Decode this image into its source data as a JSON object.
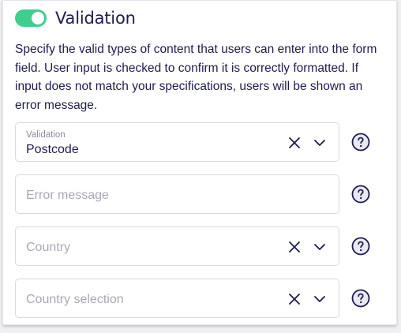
{
  "header": {
    "title": "Validation",
    "toggle_enabled": true
  },
  "description": "Specify the valid types of content that users can enter into the form field. User input is checked to confirm it is correctly formatted. If input does not match your specifications, users will be shown an error message.",
  "fields": {
    "validation": {
      "label": "Validation",
      "value": "Postcode"
    },
    "error_message": {
      "placeholder": "Error message"
    },
    "country": {
      "placeholder": "Country"
    },
    "country_selection": {
      "placeholder": "Country selection"
    }
  },
  "icons": {
    "clear": "close-icon",
    "dropdown": "chevron-down-icon",
    "help": "help-circle-icon"
  },
  "colors": {
    "accent_green": "#3ecf8e",
    "text_primary": "#1e1c4e",
    "border": "#d9d9e1",
    "placeholder": "#a9a8b5"
  }
}
